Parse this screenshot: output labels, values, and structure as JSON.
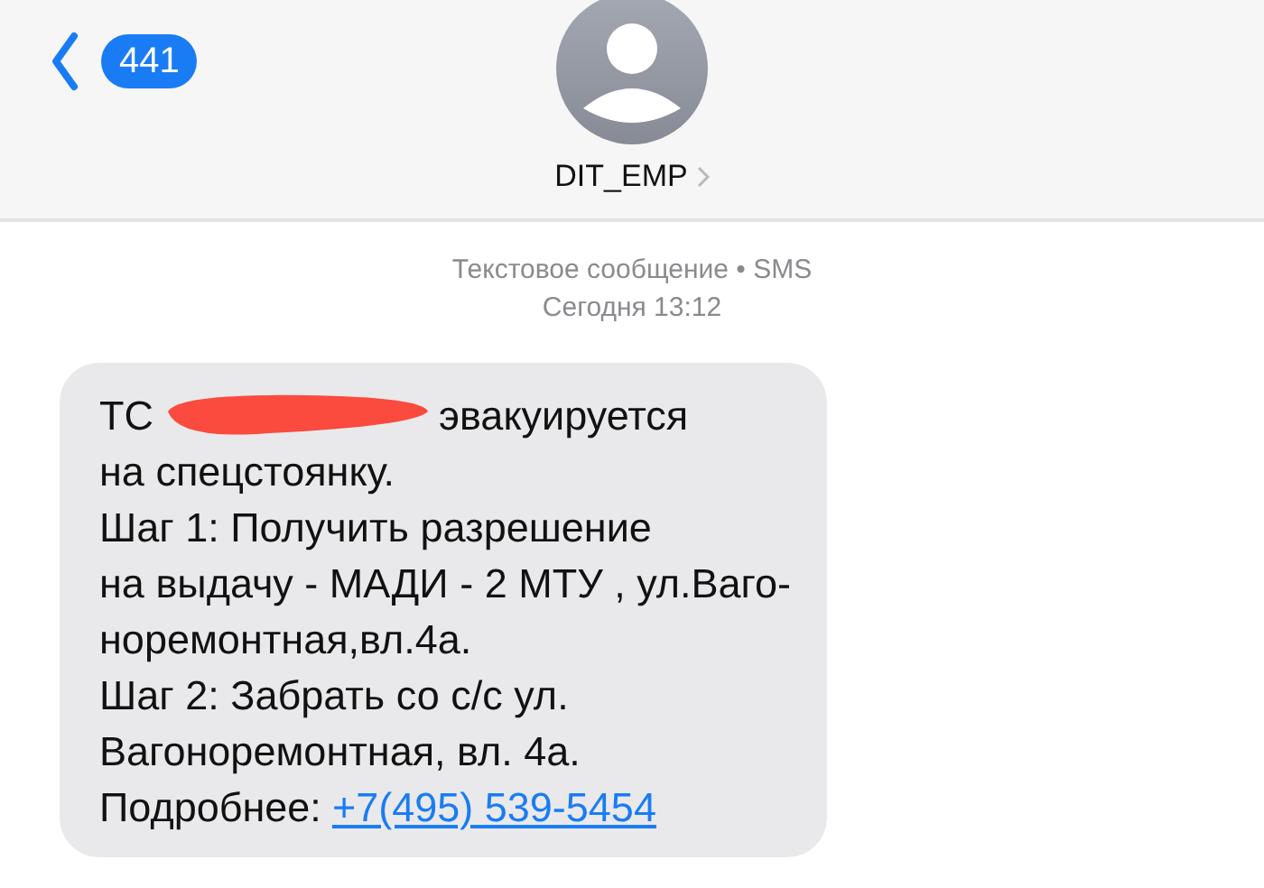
{
  "header": {
    "back_count": "441",
    "contact": "DIT_EMP"
  },
  "meta": {
    "service": "Текстовое сообщение • SMS",
    "time": "Сегодня 13:12"
  },
  "message": {
    "lines": [
      {
        "segments": [
          {
            "kind": "text",
            "text": "ТС"
          },
          {
            "kind": "redaction"
          },
          {
            "kind": "text",
            "text": "эвакуируется"
          }
        ]
      },
      {
        "segments": [
          {
            "kind": "text",
            "text": "на спецстоянку."
          }
        ]
      },
      {
        "segments": [
          {
            "kind": "text",
            "text": "Шаг 1: Получить разрешение"
          }
        ]
      },
      {
        "segments": [
          {
            "kind": "text",
            "text": "на выдачу - МАДИ - 2 МТУ , ул.Ваго-"
          }
        ]
      },
      {
        "segments": [
          {
            "kind": "text",
            "text": "норемонтная,вл.4а."
          }
        ]
      },
      {
        "segments": [
          {
            "kind": "text",
            "text": "Шаг 2: Забрать со с/с ул."
          }
        ]
      },
      {
        "segments": [
          {
            "kind": "text",
            "text": "Вагоноремонтная, вл. 4а."
          }
        ]
      },
      {
        "segments": [
          {
            "kind": "text",
            "text": "Подробнее:"
          },
          {
            "kind": "link",
            "text": "+7(495) 539-5454"
          }
        ]
      }
    ]
  }
}
